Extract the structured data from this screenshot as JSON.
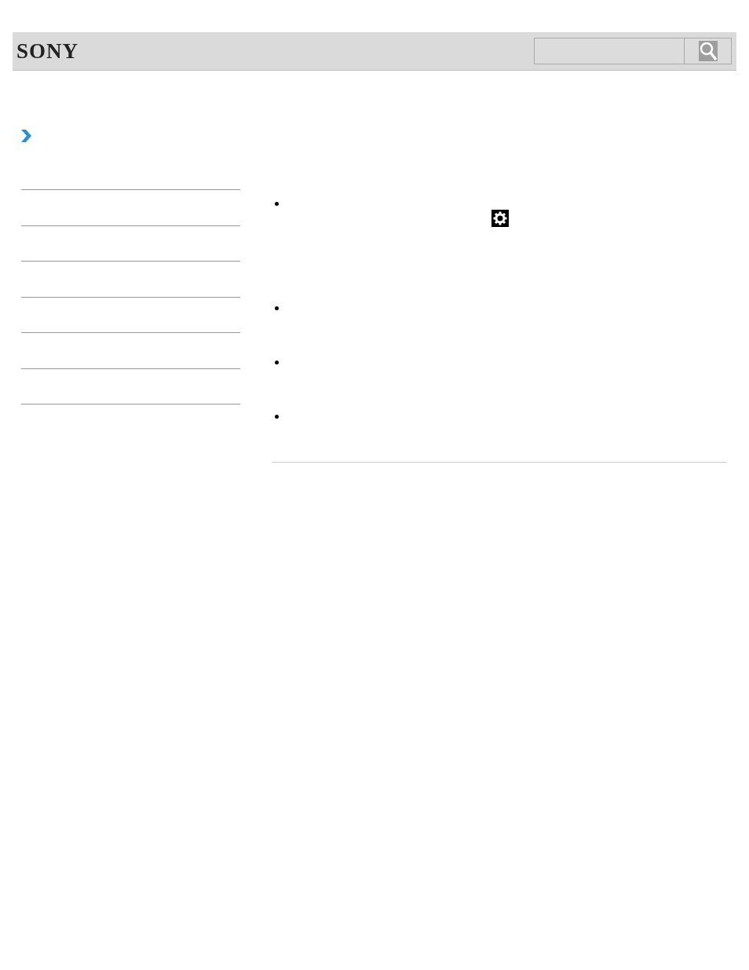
{
  "header": {
    "logo": "SONY"
  },
  "bullets": [
    {
      "gear": true
    },
    {
      "gear": false
    },
    {
      "gear": false
    },
    {
      "gear": false
    }
  ]
}
